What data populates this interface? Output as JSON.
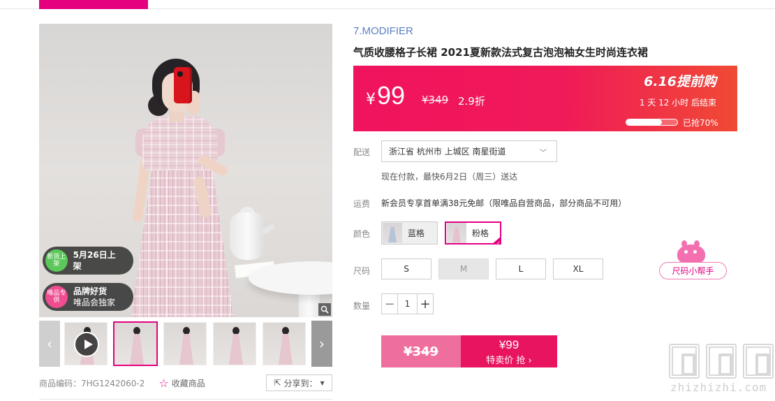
{
  "product": {
    "brand": "7.MODIFIER",
    "title": "气质收腰格子长裙 2021夏新款法式复古泡泡袖女生时尚连衣裙",
    "code": "商品编码：7HG1242060-2"
  },
  "gallery": {
    "badges": [
      {
        "icon_text": "新货上架",
        "text": "5月26日上架"
      },
      {
        "icon_text": "唯品专供",
        "text_line1": "品牌好货",
        "text_line2": "唯品会独家"
      }
    ],
    "zoom_icon": "magnifier-icon",
    "prev_icon": "chevron-left-icon",
    "next_icon": "chevron-right-icon",
    "thumbnail_count": 6,
    "selected_thumbnail": 2
  },
  "actions": {
    "favorite_label": "收藏商品",
    "share_label": "分享到："
  },
  "price": {
    "currency": "¥",
    "current": "99",
    "original": "¥349",
    "discount": "2.9折",
    "promo_logo": "6.16提前购",
    "countdown": "1  天 12 小时 后结束",
    "sold_label": "已抢70%",
    "sold_percent": 70
  },
  "delivery": {
    "label": "配送",
    "address": "浙江省 杭州市 上城区 南星街道",
    "note": "现在付款，最快6月2日（周三）送达"
  },
  "shipping": {
    "label": "运费",
    "text": "新会员专享首单满38元免邮（限唯品自营商品，部分商品不可用）"
  },
  "colors": {
    "label": "颜色",
    "options": [
      {
        "name": "蓝格",
        "selected": false
      },
      {
        "name": "粉格",
        "selected": true
      }
    ]
  },
  "sizes": {
    "label": "尺码",
    "options": [
      {
        "name": "S",
        "available": true
      },
      {
        "name": "M",
        "available": false
      },
      {
        "name": "L",
        "available": true
      },
      {
        "name": "XL",
        "available": true
      }
    ],
    "helper_label": "尺码小帮手"
  },
  "quantity": {
    "label": "数量",
    "value": "1",
    "minus": "−",
    "plus": "+"
  },
  "buy": {
    "original_price": "¥349",
    "special_price": "¥99",
    "special_label": "特卖价 抢 ›"
  },
  "watermark": {
    "text": "zhizhizhi.com"
  },
  "colors_theme": {
    "accent": "#e4007f",
    "price_gradient_start": "#f0135e",
    "price_gradient_end": "#f04a34",
    "brand_blue": "#5a7fc6"
  }
}
